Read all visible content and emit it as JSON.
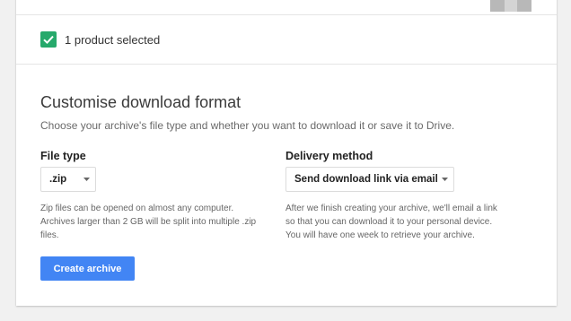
{
  "selection": {
    "text": "1 product selected"
  },
  "format": {
    "title": "Customise download format",
    "subtitle": "Choose your archive's file type and whether you want to download it or save it to Drive.",
    "file_type": {
      "label": "File type",
      "value": ".zip",
      "help": [
        "Zip files can be opened on almost any computer.",
        "Archives larger than 2 GB will be split into multiple .zip",
        "files."
      ]
    },
    "delivery": {
      "label": "Delivery method",
      "value": "Send download link via email",
      "help": [
        "After we finish creating your archive, we'll email a link",
        "so that you can download it to your personal device.",
        "You will have one week to retrieve your archive."
      ]
    },
    "create_button": "Create archive"
  },
  "colors": {
    "accent_blue": "#4285f4",
    "check_green": "#26a96b",
    "background": "#f1f1f1"
  },
  "icons": {
    "checkbox": "check-icon",
    "dropdown": "caret-down-icon",
    "top_graphic": "archive-box-icon"
  }
}
